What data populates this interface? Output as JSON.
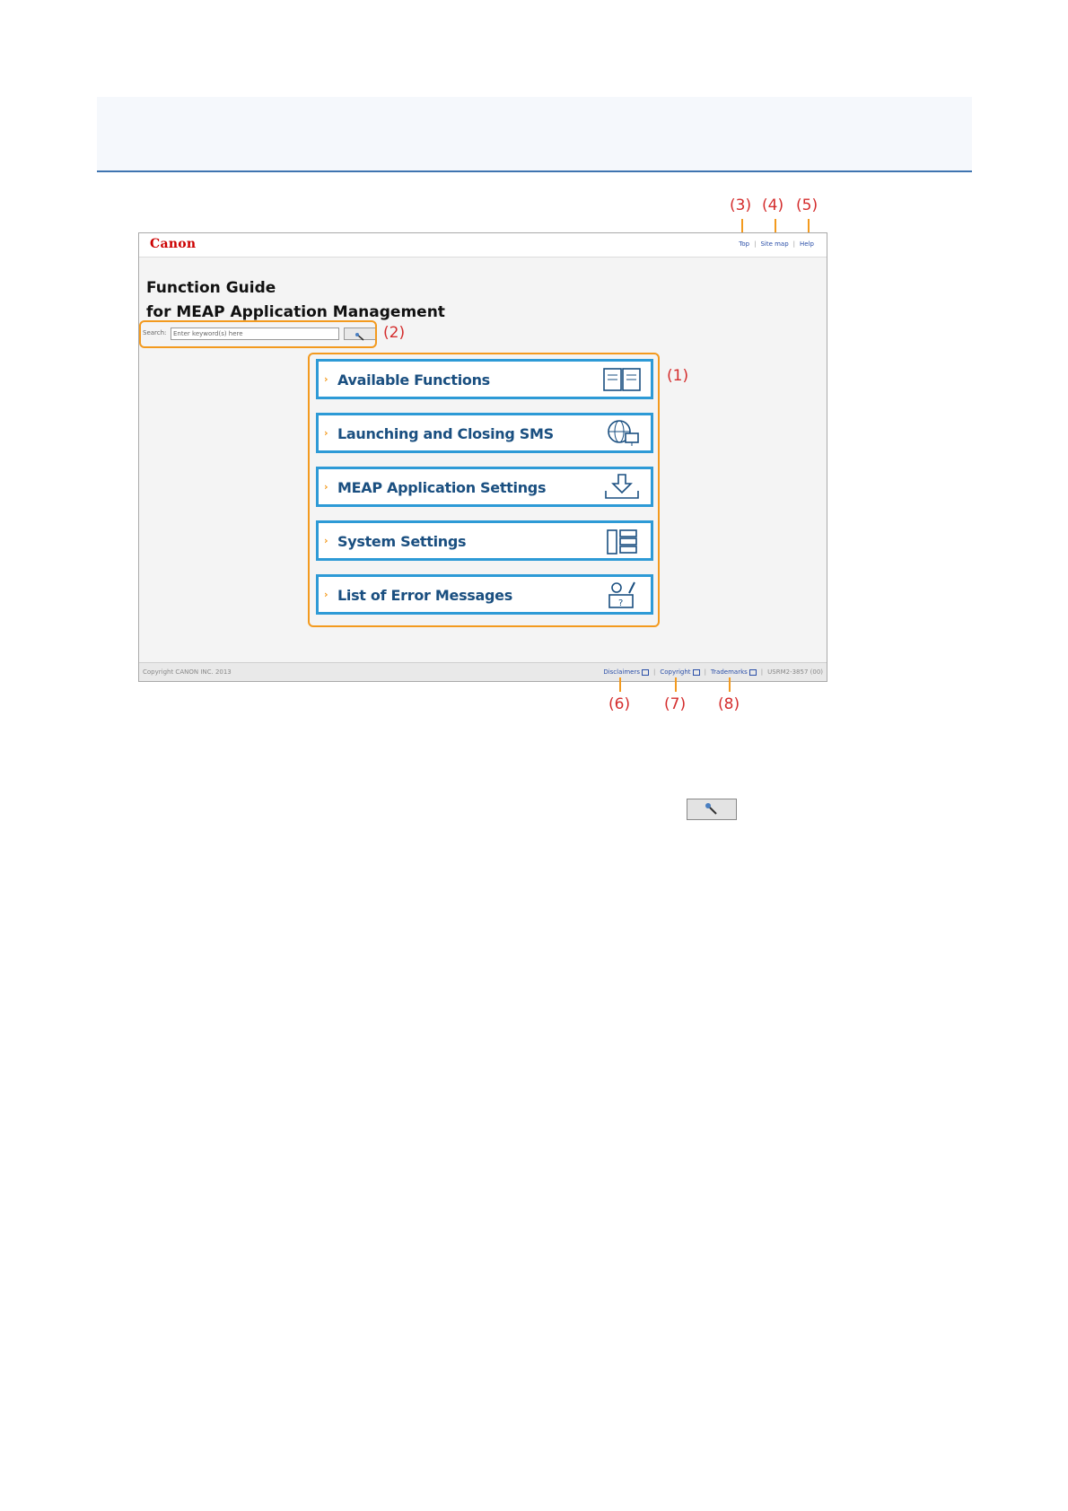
{
  "screenshot": {
    "logo": "Canon",
    "top_links": [
      "Top",
      "Site map",
      "Help"
    ],
    "title_line1": "Function Guide",
    "title_line2": "for MEAP Application Management",
    "search_label": "Search:",
    "search_value": "Enter keyword(s) here",
    "menu": [
      {
        "label": "Available Functions",
        "icon": "book-icon"
      },
      {
        "label": "Launching and Closing SMS",
        "icon": "globe-monitor-icon"
      },
      {
        "label": "MEAP Application Settings",
        "icon": "download-tray-icon"
      },
      {
        "label": "System Settings",
        "icon": "panel-list-icon"
      },
      {
        "label": "List of Error Messages",
        "icon": "error-box-icon"
      }
    ],
    "footer": {
      "copyright": "Copyright CANON INC. 2013",
      "links": [
        "Disclaimers",
        "Copyright",
        "Trademarks"
      ],
      "version": "USRM2-3857 (00)"
    }
  },
  "callouts": {
    "c1": "(1)",
    "c2": "(2)",
    "c3": "(3)",
    "c4": "(4)",
    "c5": "(5)",
    "c6": "(6)",
    "c7": "(7)",
    "c8": "(8)"
  }
}
